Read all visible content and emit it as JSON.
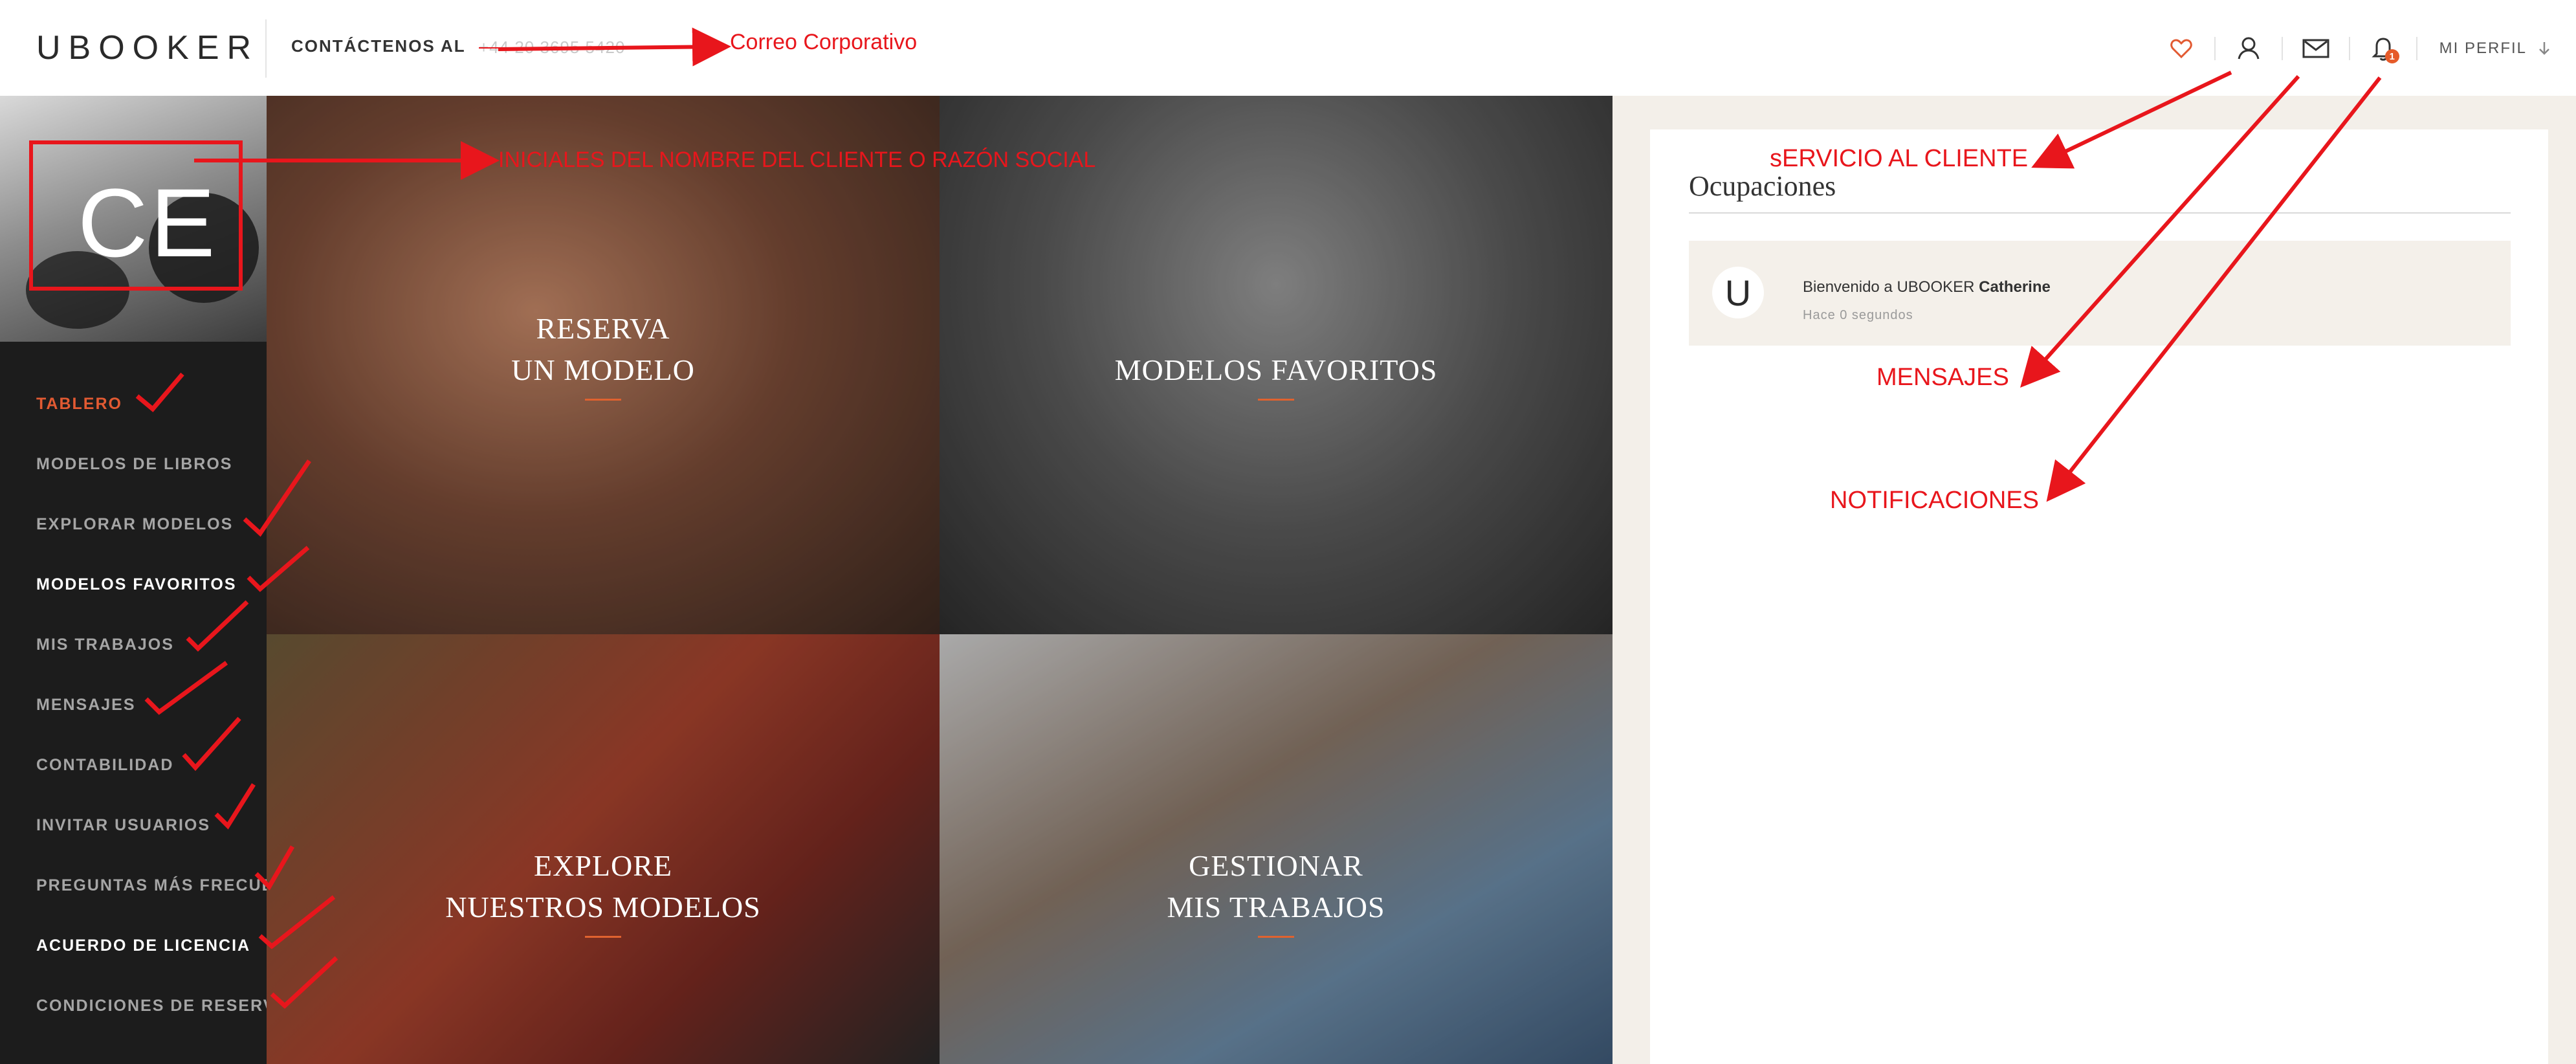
{
  "header": {
    "logo": "UBOOKER",
    "contact_label": "CONTÁCTENOS AL",
    "phone": "+44 20 3695 5420",
    "profile_label": "MI PERFIL",
    "notification_count": "1"
  },
  "sidebar": {
    "initials": "CE",
    "items": [
      {
        "label": "TABLERO"
      },
      {
        "label": "MODELOS DE LIBROS"
      },
      {
        "label": "EXPLORAR MODELOS"
      },
      {
        "label": "MODELOS FAVORITOS"
      },
      {
        "label": "MIS TRABAJOS"
      },
      {
        "label": "MENSAJES"
      },
      {
        "label": "CONTABILIDAD"
      },
      {
        "label": "INVITAR USUARIOS"
      },
      {
        "label": "PREGUNTAS MÁS FRECUENTES"
      },
      {
        "label": "ACUERDO DE LICENCIA"
      },
      {
        "label": "CONDICIONES DE RESERVA"
      }
    ]
  },
  "tiles": [
    {
      "line1": "RESERVA",
      "line2": "UN MODELO"
    },
    {
      "line1": "MODELOS FAVORITOS",
      "line2": ""
    },
    {
      "line1": "EXPLORE",
      "line2": "NUESTROS MODELOS"
    },
    {
      "line1": "GESTIONAR",
      "line2": "MIS TRABAJOS"
    }
  ],
  "panel": {
    "title": "Ocupaciones",
    "notification": {
      "avatar_letter": "U",
      "text": "Bienvenido a UBOOKER",
      "name": "Catherine",
      "time": "Hace 0 segundos"
    }
  },
  "annotations": {
    "corporate_email": "Correo Corporativo",
    "initials_note": "INICIALES DEL NOMBRE DEL CLIENTE O RAZÓN SOCIAL",
    "customer_service": "sERVICIO AL CLIENTE",
    "messages": "MENSAJES",
    "notifications": "NOTIFICACIONES"
  },
  "colors": {
    "accent": "#e25a32",
    "annotation": "#e8161c",
    "sidebar_bg": "#1c1c1c",
    "panel_bg": "#f3efe9"
  },
  "icons": [
    "heart-icon",
    "user-icon",
    "mail-icon",
    "bell-icon",
    "chevron-down-icon"
  ]
}
